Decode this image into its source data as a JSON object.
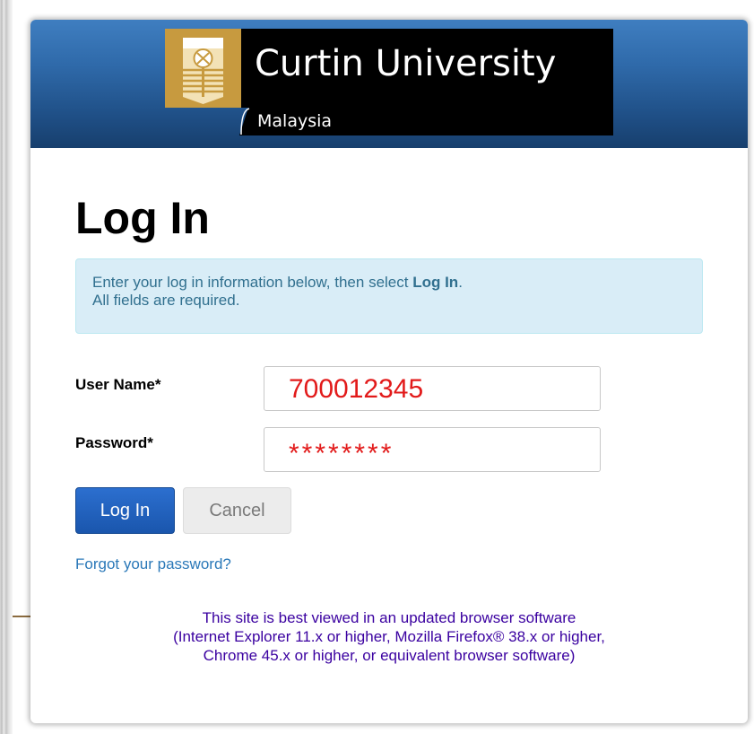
{
  "banner": {
    "logo_title": "Curtin University",
    "logo_subtitle": "Malaysia",
    "colors": {
      "banner_top": "#3f7ec0",
      "banner_bottom": "#173f6d",
      "emblem_gold": "#c79a3f"
    }
  },
  "page": {
    "heading": "Log In"
  },
  "info": {
    "line1_prefix": "Enter your log in information below, then select ",
    "line1_bold": "Log In",
    "line1_suffix": ".",
    "line2": "All fields are required."
  },
  "form": {
    "username_label": "User Name*",
    "username_value": "700012345",
    "password_label": "Password*",
    "password_value": "********",
    "login_button": "Log In",
    "cancel_button": "Cancel",
    "forgot_link": "Forgot your password?"
  },
  "browser_note": {
    "line1": "This site is best viewed in an updated browser software",
    "line2": "(Internet Explorer 11.x or higher, Mozilla Firefox® 38.x or higher,",
    "line3": "Chrome 45.x or higher, or equivalent browser software)"
  },
  "icons": {
    "university_emblem": "curtin-emblem-icon"
  }
}
